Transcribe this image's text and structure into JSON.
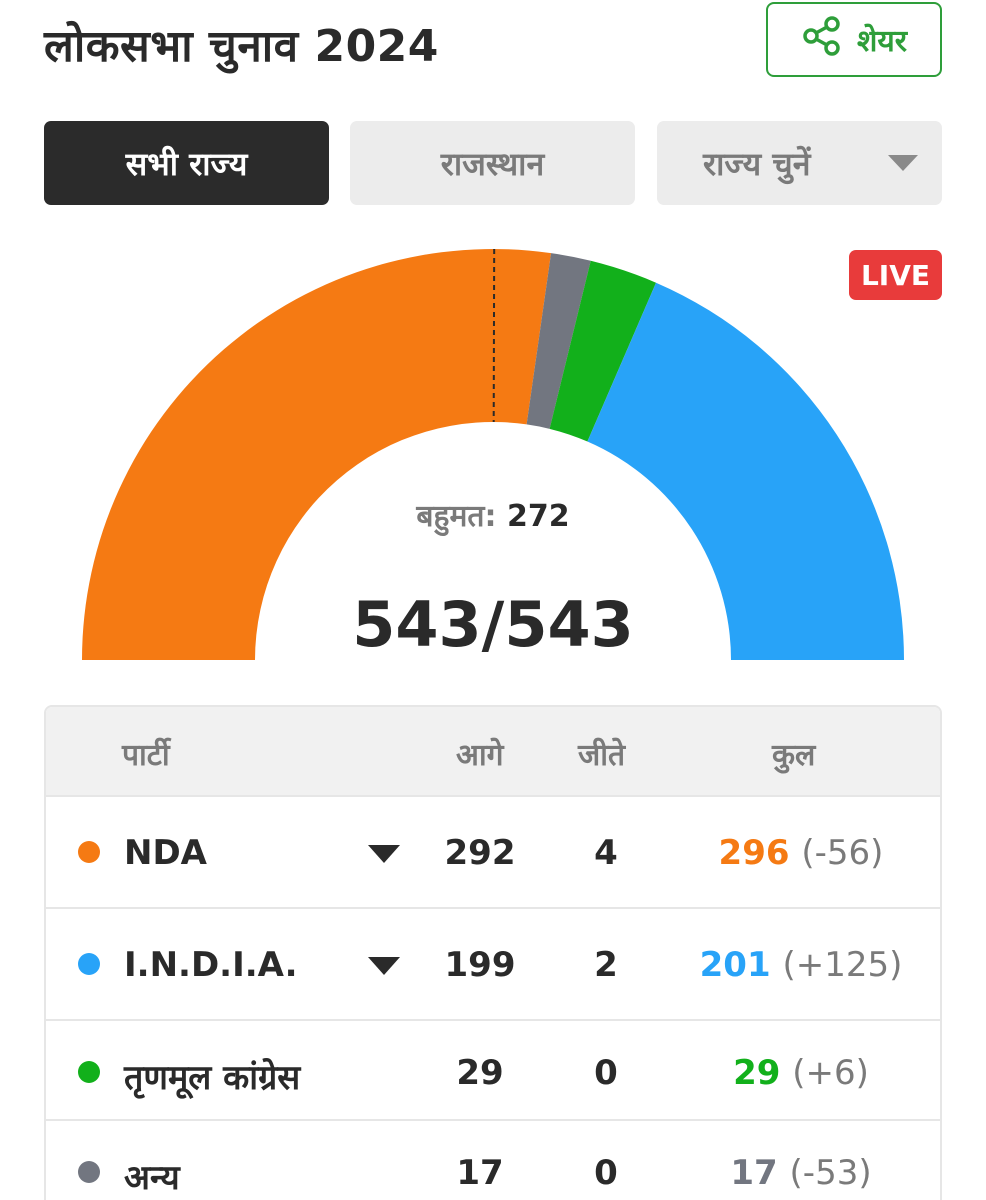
{
  "header": {
    "title": "लोकसभा चुनाव 2024",
    "share_label": "शेयर"
  },
  "tabs": [
    {
      "label": "सभी राज्य",
      "active": true
    },
    {
      "label": "राजस्थान",
      "active": false
    }
  ],
  "state_select": {
    "label": "राज्य चुनें"
  },
  "live_badge": "LIVE",
  "summary": {
    "majority_label": "बहुमत:",
    "majority_value": "272",
    "seats_text": "543/543",
    "total_seats": 543
  },
  "chart_data": {
    "type": "pie",
    "shape": "semicircle-donut",
    "total": 543,
    "majority": 272,
    "segments": [
      {
        "name": "NDA",
        "value": 296,
        "color": "#f57a13"
      },
      {
        "name": "अन्य",
        "value": 17,
        "color": "#727680"
      },
      {
        "name": "तृणमूल कांग्रेस",
        "value": 29,
        "color": "#12b01b"
      },
      {
        "name": "I.N.D.I.A.",
        "value": 201,
        "color": "#28a3f8"
      }
    ]
  },
  "table": {
    "headers": {
      "party": "पार्टी",
      "leading": "आगे",
      "won": "जीते",
      "total": "कुल"
    },
    "rows": [
      {
        "party": "NDA",
        "color": "#f57a13",
        "leading": "292",
        "won": "4",
        "total": "296",
        "change": "(-56)",
        "total_color": "#f57a13",
        "expandable": true
      },
      {
        "party": "I.N.D.I.A.",
        "color": "#28a3f8",
        "leading": "199",
        "won": "2",
        "total": "201",
        "change": "(+125)",
        "total_color": "#28a3f8",
        "expandable": true
      },
      {
        "party": "तृणमूल कांग्रेस",
        "color": "#12b01b",
        "leading": "29",
        "won": "0",
        "total": "29",
        "change": "(+6)",
        "total_color": "#12b01b",
        "expandable": false
      },
      {
        "party": "अन्य",
        "color": "#727680",
        "leading": "17",
        "won": "0",
        "total": "17",
        "change": "(-53)",
        "total_color": "#727680",
        "expandable": false
      }
    ]
  }
}
